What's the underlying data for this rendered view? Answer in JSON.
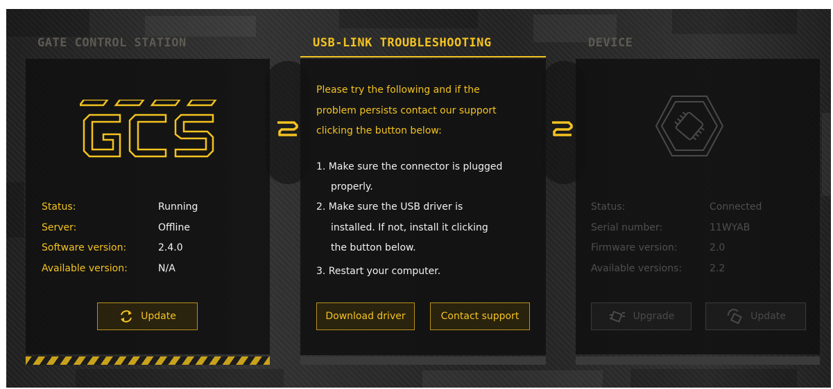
{
  "colors": {
    "accent": "#f3c321",
    "text": "#f2f2f2",
    "dim": "#4f4f4f",
    "panel": "#151515"
  },
  "gcs": {
    "title": "GATE CONTROL STATION",
    "logo_text": "GCS",
    "rows": [
      {
        "label": "Status:",
        "value": "Running"
      },
      {
        "label": "Server:",
        "value": "Offline"
      },
      {
        "label": "Software version:",
        "value": "2.4.0"
      },
      {
        "label": "Available version:",
        "value": "N/A"
      }
    ],
    "update_label": "Update",
    "update_icon": "refresh-icon"
  },
  "troubleshooting": {
    "title": "USB-LINK TROUBLESHOOTING",
    "intro": [
      "Please try the following and if the",
      "problem persists contact our support",
      "clicking the button below:"
    ],
    "steps": [
      "1. Make sure the connector is plugged",
      "properly.",
      "2. Make sure the USB driver is",
      "installed. If not, install it clicking",
      "the button below.",
      "3. Restart your computer."
    ],
    "download_label": "Download driver",
    "contact_label": "Contact support"
  },
  "device": {
    "title": "DEVICE",
    "chip_icon": "chip-icon",
    "rows": [
      {
        "label": "Status:",
        "value": "Connected"
      },
      {
        "label": "Serial number:",
        "value": "11WYAB"
      },
      {
        "label": "Firmware version:",
        "value": "2.0"
      },
      {
        "label": "Available versions:",
        "value": "2.2"
      }
    ],
    "upgrade_label": "Upgrade",
    "update_label": "Update",
    "upgrade_icon": "upgrade-chip-icon",
    "update_icon": "update-chip-icon"
  },
  "bridge_icons": [
    "usb-link-icon",
    "usb-link-icon"
  ]
}
